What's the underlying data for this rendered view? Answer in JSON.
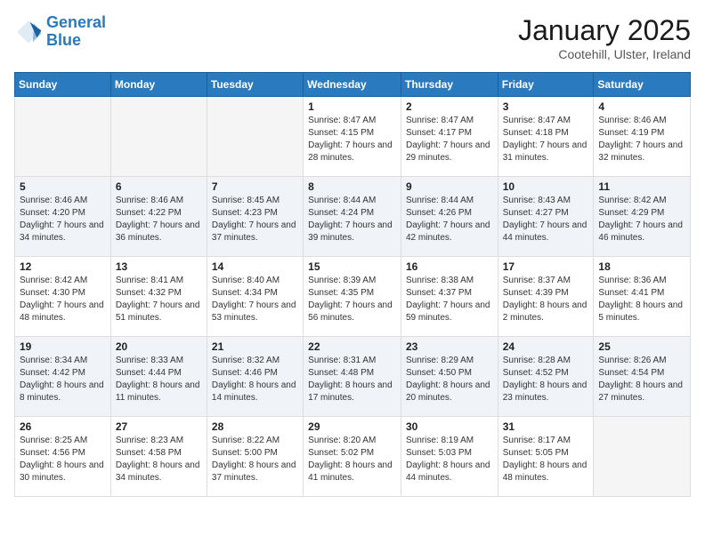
{
  "logo": {
    "line1": "General",
    "line2": "Blue"
  },
  "title": "January 2025",
  "subtitle": "Cootehill, Ulster, Ireland",
  "days_header": [
    "Sunday",
    "Monday",
    "Tuesday",
    "Wednesday",
    "Thursday",
    "Friday",
    "Saturday"
  ],
  "weeks": [
    [
      {
        "day": "",
        "empty": true
      },
      {
        "day": "",
        "empty": true
      },
      {
        "day": "",
        "empty": true
      },
      {
        "day": "1",
        "sunrise": "8:47 AM",
        "sunset": "4:15 PM",
        "daylight": "7 hours and 28 minutes."
      },
      {
        "day": "2",
        "sunrise": "8:47 AM",
        "sunset": "4:17 PM",
        "daylight": "7 hours and 29 minutes."
      },
      {
        "day": "3",
        "sunrise": "8:47 AM",
        "sunset": "4:18 PM",
        "daylight": "7 hours and 31 minutes."
      },
      {
        "day": "4",
        "sunrise": "8:46 AM",
        "sunset": "4:19 PM",
        "daylight": "7 hours and 32 minutes."
      }
    ],
    [
      {
        "day": "5",
        "sunrise": "8:46 AM",
        "sunset": "4:20 PM",
        "daylight": "7 hours and 34 minutes."
      },
      {
        "day": "6",
        "sunrise": "8:46 AM",
        "sunset": "4:22 PM",
        "daylight": "7 hours and 36 minutes."
      },
      {
        "day": "7",
        "sunrise": "8:45 AM",
        "sunset": "4:23 PM",
        "daylight": "7 hours and 37 minutes."
      },
      {
        "day": "8",
        "sunrise": "8:44 AM",
        "sunset": "4:24 PM",
        "daylight": "7 hours and 39 minutes."
      },
      {
        "day": "9",
        "sunrise": "8:44 AM",
        "sunset": "4:26 PM",
        "daylight": "7 hours and 42 minutes."
      },
      {
        "day": "10",
        "sunrise": "8:43 AM",
        "sunset": "4:27 PM",
        "daylight": "7 hours and 44 minutes."
      },
      {
        "day": "11",
        "sunrise": "8:42 AM",
        "sunset": "4:29 PM",
        "daylight": "7 hours and 46 minutes."
      }
    ],
    [
      {
        "day": "12",
        "sunrise": "8:42 AM",
        "sunset": "4:30 PM",
        "daylight": "7 hours and 48 minutes."
      },
      {
        "day": "13",
        "sunrise": "8:41 AM",
        "sunset": "4:32 PM",
        "daylight": "7 hours and 51 minutes."
      },
      {
        "day": "14",
        "sunrise": "8:40 AM",
        "sunset": "4:34 PM",
        "daylight": "7 hours and 53 minutes."
      },
      {
        "day": "15",
        "sunrise": "8:39 AM",
        "sunset": "4:35 PM",
        "daylight": "7 hours and 56 minutes."
      },
      {
        "day": "16",
        "sunrise": "8:38 AM",
        "sunset": "4:37 PM",
        "daylight": "7 hours and 59 minutes."
      },
      {
        "day": "17",
        "sunrise": "8:37 AM",
        "sunset": "4:39 PM",
        "daylight": "8 hours and 2 minutes."
      },
      {
        "day": "18",
        "sunrise": "8:36 AM",
        "sunset": "4:41 PM",
        "daylight": "8 hours and 5 minutes."
      }
    ],
    [
      {
        "day": "19",
        "sunrise": "8:34 AM",
        "sunset": "4:42 PM",
        "daylight": "8 hours and 8 minutes."
      },
      {
        "day": "20",
        "sunrise": "8:33 AM",
        "sunset": "4:44 PM",
        "daylight": "8 hours and 11 minutes."
      },
      {
        "day": "21",
        "sunrise": "8:32 AM",
        "sunset": "4:46 PM",
        "daylight": "8 hours and 14 minutes."
      },
      {
        "day": "22",
        "sunrise": "8:31 AM",
        "sunset": "4:48 PM",
        "daylight": "8 hours and 17 minutes."
      },
      {
        "day": "23",
        "sunrise": "8:29 AM",
        "sunset": "4:50 PM",
        "daylight": "8 hours and 20 minutes."
      },
      {
        "day": "24",
        "sunrise": "8:28 AM",
        "sunset": "4:52 PM",
        "daylight": "8 hours and 23 minutes."
      },
      {
        "day": "25",
        "sunrise": "8:26 AM",
        "sunset": "4:54 PM",
        "daylight": "8 hours and 27 minutes."
      }
    ],
    [
      {
        "day": "26",
        "sunrise": "8:25 AM",
        "sunset": "4:56 PM",
        "daylight": "8 hours and 30 minutes."
      },
      {
        "day": "27",
        "sunrise": "8:23 AM",
        "sunset": "4:58 PM",
        "daylight": "8 hours and 34 minutes."
      },
      {
        "day": "28",
        "sunrise": "8:22 AM",
        "sunset": "5:00 PM",
        "daylight": "8 hours and 37 minutes."
      },
      {
        "day": "29",
        "sunrise": "8:20 AM",
        "sunset": "5:02 PM",
        "daylight": "8 hours and 41 minutes."
      },
      {
        "day": "30",
        "sunrise": "8:19 AM",
        "sunset": "5:03 PM",
        "daylight": "8 hours and 44 minutes."
      },
      {
        "day": "31",
        "sunrise": "8:17 AM",
        "sunset": "5:05 PM",
        "daylight": "8 hours and 48 minutes."
      },
      {
        "day": "",
        "empty": true
      }
    ]
  ]
}
